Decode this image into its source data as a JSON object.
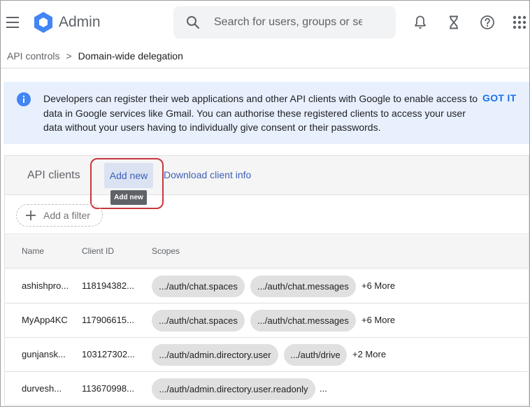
{
  "header": {
    "app_title": "Admin",
    "search_placeholder": "Search for users, groups or se",
    "icons": [
      "menu-icon",
      "admin-logo-icon",
      "search-icon",
      "notifications-bell-icon",
      "tasks-hourglass-icon",
      "help-icon",
      "apps-grid-icon"
    ],
    "brand_color": "#4285f4"
  },
  "breadcrumb": {
    "parent": "API controls",
    "separator": ">",
    "current": "Domain-wide delegation"
  },
  "banner": {
    "text": "Developers can register their web applications and other API clients with Google to enable access to data in Google services like Gmail. You can authorise these registered clients to access your user data without your users having to individually give consent or their passwords.",
    "action": "GOT IT",
    "icon": "info-icon",
    "background": "#e8f0fe"
  },
  "clients_card": {
    "title": "API clients",
    "add_new_label": "Add new",
    "add_new_tooltip": "Add new",
    "download_label": "Download client info",
    "filter_label": "Add a filter",
    "columns": [
      "Name",
      "Client ID",
      "Scopes"
    ],
    "rows": [
      {
        "name": "ashishpro...",
        "client_id": "118194382...",
        "scopes": [
          ".../auth/chat.spaces",
          ".../auth/chat.messages"
        ],
        "more": "+6 More"
      },
      {
        "name": "MyApp4KC",
        "client_id": "117906615...",
        "scopes": [
          ".../auth/chat.spaces",
          ".../auth/chat.messages"
        ],
        "more": "+6 More"
      },
      {
        "name": "gunjansk...",
        "client_id": "103127302...",
        "scopes": [
          ".../auth/admin.directory.user",
          ".../auth/drive"
        ],
        "more": "+2 More"
      },
      {
        "name": "durvesh...",
        "client_id": "113670998...",
        "scopes": [
          ".../auth/admin.directory.user.readonly"
        ],
        "more": "..."
      }
    ],
    "accent_color": "#3c5fb5",
    "highlight_color": "#c8373c"
  }
}
